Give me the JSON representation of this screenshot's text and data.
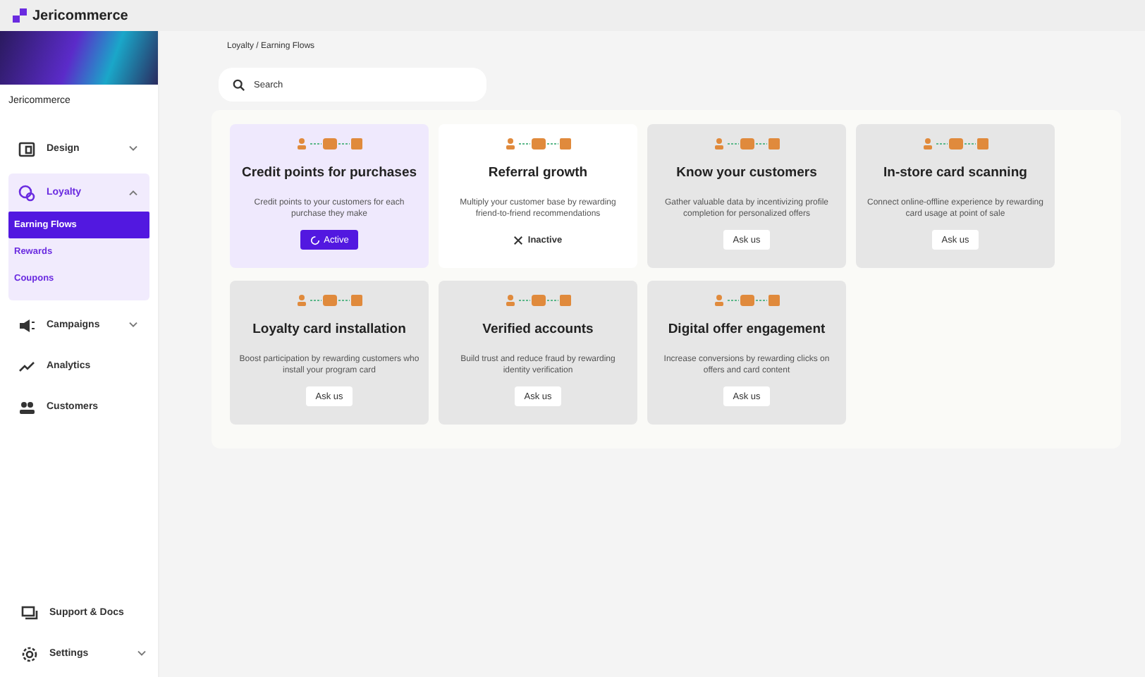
{
  "brand": {
    "name": "Jericommerce"
  },
  "sidebar": {
    "store_name": "Jericommerce",
    "items": [
      {
        "label": "Design",
        "kind": "design",
        "expanded": false
      },
      {
        "label": "Loyalty",
        "kind": "loyalty",
        "expanded": true,
        "children": [
          {
            "label": "Earning Flows",
            "selected": true
          },
          {
            "label": "Rewards",
            "selected": false
          },
          {
            "label": "Coupons",
            "selected": false
          }
        ]
      },
      {
        "label": "Campaigns",
        "kind": "campaigns",
        "expanded": false
      },
      {
        "label": "Analytics",
        "kind": "analytics"
      },
      {
        "label": "Customers",
        "kind": "customers"
      }
    ],
    "bottom_items": [
      {
        "label": "Support & Docs",
        "kind": "support"
      },
      {
        "label": "Settings",
        "kind": "settings",
        "expanded": false
      }
    ]
  },
  "breadcrumb": "Loyalty / Earning Flows",
  "search": {
    "placeholder": "Search"
  },
  "flows": [
    {
      "title": "Credit points for purchases",
      "description": "Credit points to your customers for each purchase they make",
      "kind": "active",
      "action": "Active"
    },
    {
      "title": "Referral growth",
      "description": "Multiply your customer base by rewarding friend-to-friend recommendations",
      "kind": "inactive",
      "action": "Inactive"
    },
    {
      "title": "Know your customers",
      "description": "Gather valuable data by incentivizing profile completion for personalized offers",
      "kind": "ask",
      "action": "Ask us"
    },
    {
      "title": "In-store card scanning",
      "description": "Connect online-offline experience by rewarding card usage at point of sale",
      "kind": "ask",
      "action": "Ask us"
    },
    {
      "title": "Loyalty card installation",
      "description": "Boost participation by rewarding customers who install your program card",
      "kind": "ask",
      "action": "Ask us"
    },
    {
      "title": "Verified accounts",
      "description": "Build trust and reduce fraud by rewarding identity verification",
      "kind": "ask",
      "action": "Ask us"
    },
    {
      "title": "Digital offer engagement",
      "description": "Increase conversions by rewarding clicks on offers and card content",
      "kind": "ask",
      "action": "Ask us"
    }
  ]
}
